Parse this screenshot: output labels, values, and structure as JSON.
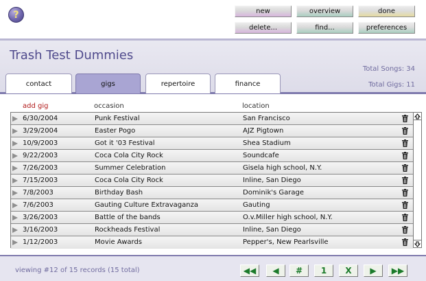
{
  "toolbar": {
    "new": "new",
    "overview": "overview",
    "done": "done",
    "delete": "delete...",
    "find": "find...",
    "preferences": "preferences"
  },
  "help": {
    "label": "?"
  },
  "header": {
    "title": "Trash Test Dummies",
    "total_songs": "Total Songs: 34",
    "total_gigs": "Total Gigs: 11"
  },
  "tabs": [
    {
      "label": "contact",
      "active": false
    },
    {
      "label": "gigs",
      "active": true
    },
    {
      "label": "repertoire",
      "active": false
    },
    {
      "label": "finance",
      "active": false
    }
  ],
  "list": {
    "add_label": "add gig",
    "occasion_header": "occasion",
    "location_header": "location",
    "rows": [
      {
        "date": "6/30/2004",
        "occasion": "Punk Festival",
        "location": "San Francisco"
      },
      {
        "date": "3/29/2004",
        "occasion": "Easter Pogo",
        "location": "AJZ Pigtown"
      },
      {
        "date": "10/9/2003",
        "occasion": "Got it '03 Festival",
        "location": "Shea Stadium"
      },
      {
        "date": "9/22/2003",
        "occasion": "Coca Cola City Rock",
        "location": "Soundcafe"
      },
      {
        "date": "7/26/2003",
        "occasion": "Summer Celebration",
        "location": "Gisela high school, N.Y."
      },
      {
        "date": "7/15/2003",
        "occasion": "Coca Cola City Rock",
        "location": "Inline, San Diego"
      },
      {
        "date": "7/8/2003",
        "occasion": "Birthday Bash",
        "location": "Dominik's Garage"
      },
      {
        "date": "7/6/2003",
        "occasion": "Gauting Culture Extravaganza",
        "location": "Gauting"
      },
      {
        "date": "3/26/2003",
        "occasion": "Battle of the bands",
        "location": "O.v.Miller high school, N.Y."
      },
      {
        "date": "3/16/2003",
        "occasion": "Rockheads Festival",
        "location": "Inline, San Diego"
      },
      {
        "date": "1/12/2003",
        "occasion": "Movie Awards",
        "location": "Pepper's, New Pearlsville"
      }
    ]
  },
  "footer": {
    "status": "viewing #12 of 15 records (15 total)",
    "pager": {
      "first": "◀◀",
      "prev": "◀",
      "hash": "#",
      "page": "1",
      "x": "X",
      "next": "▶",
      "last": "▶▶"
    }
  },
  "colors": {
    "accent": "#4f4a8c",
    "band": "#e6e5f0",
    "active_tab": "#a9a5d3",
    "add_link": "#b11a1a",
    "pager_glyph": "#1b7a2a"
  },
  "icons": {
    "help": "help-icon",
    "row_arrow": "triangle-right-icon",
    "row_delete": "trash-icon",
    "scroll_up": "arrow-up-icon",
    "scroll_down": "arrow-down-icon"
  }
}
